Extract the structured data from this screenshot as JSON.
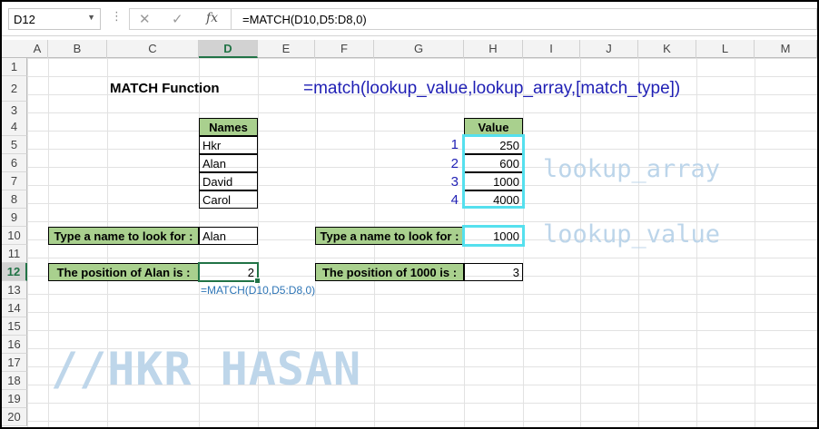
{
  "formula_bar": {
    "name_box": "D12",
    "cancel_glyph": "✕",
    "enter_glyph": "✓",
    "fx_label": "fx",
    "formula": "=MATCH(D10,D5:D8,0)"
  },
  "columns": [
    "A",
    "B",
    "C",
    "D",
    "E",
    "F",
    "G",
    "H",
    "I",
    "J",
    "K",
    "L",
    "M"
  ],
  "selected_column": "D",
  "rows": [
    "1",
    "2",
    "3",
    "4",
    "5",
    "6",
    "7",
    "8",
    "9",
    "10",
    "11",
    "12",
    "13",
    "14",
    "15",
    "16",
    "17",
    "18",
    "19",
    "20"
  ],
  "selected_row": "12",
  "sheet": {
    "title": "MATCH Function",
    "syntax": "=match(lookup_value,lookup_array,[match_type])",
    "names_table": {
      "header": "Names",
      "items": [
        "Hkr",
        "Alan",
        "David",
        "Carol"
      ]
    },
    "value_table": {
      "header": "Value",
      "items": [
        "250",
        "600",
        "1000",
        "4000"
      ],
      "positions": [
        "1",
        "2",
        "3",
        "4"
      ]
    },
    "left_lookup": {
      "label": "Type a name to look for :",
      "value": "Alan",
      "result_label": "The position of Alan is :",
      "result": "2",
      "formula_note": "=MATCH(D10,D5:D8,0)"
    },
    "right_lookup": {
      "label": "Type a name to look for :",
      "value": "1000",
      "result_label": "The position of 1000 is :",
      "result": "3"
    },
    "annotations": {
      "array": "lookup_array",
      "value": "lookup_value"
    },
    "watermark": "//HKR HASAN"
  },
  "colors": {
    "header_green": "#a9d08e",
    "highlight_cyan": "#55e0ee",
    "syntax_blue": "#1f1fb4",
    "excel_green": "#217346"
  }
}
